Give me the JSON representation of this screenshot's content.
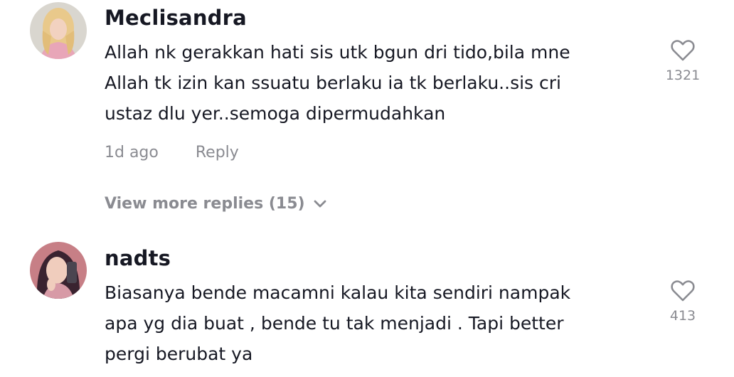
{
  "comments": [
    {
      "username": "Meclisandra",
      "text_lines": [
        "Allah nk gerakkan hati sis utk bgun dri tido,bila mne",
        "Allah tk izin kan ssuatu berlaku ia tk berlaku..sis cri",
        "ustaz dlu yer..semoga dipermudahkan"
      ],
      "timestamp": "1d ago",
      "reply_label": "Reply",
      "like_count": "1321",
      "view_more": "View more replies (15)"
    },
    {
      "username": "nadts",
      "text_lines": [
        "Biasanya bende macamni kalau kita sendiri nampak",
        "apa yg dia buat , bende tu tak menjadi . Tapi better",
        "pergi berubat ya"
      ],
      "like_count": "413"
    }
  ],
  "icons": {
    "like": "heart-outline-icon",
    "expand": "chevron-down-icon"
  },
  "colors": {
    "text_primary": "#161823",
    "text_secondary": "#8a8b91"
  }
}
